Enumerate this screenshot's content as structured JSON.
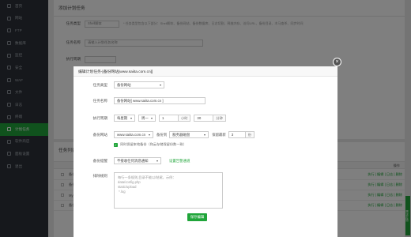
{
  "sidebar": {
    "items": [
      {
        "label": "首页"
      },
      {
        "label": "网站"
      },
      {
        "label": "FTP"
      },
      {
        "label": "数据库"
      },
      {
        "label": "监控"
      },
      {
        "label": "安全"
      },
      {
        "label": "WAF"
      },
      {
        "label": "文件"
      },
      {
        "label": "日志"
      },
      {
        "label": "终端"
      },
      {
        "label": "计划任务"
      },
      {
        "label": "软件商店"
      },
      {
        "label": "面板设置"
      },
      {
        "label": "退出"
      }
    ],
    "active_index": 10
  },
  "background": {
    "panel_title": "添加计划任务",
    "task_type_label": "任务类型",
    "task_type_value": "Shell脚本",
    "task_type_hint": "* 任务类型包含以下部分：Shell脚本、备份网站、备份数据库、日志切割、释放内存、访问URL、备份目录、木马查杀、同步时间",
    "task_name_label": "任务名称",
    "task_name_placeholder": "请输入计划任务名称",
    "exec_cycle_label": "执行周期",
    "list_title": "任务列表",
    "op_header": "操作",
    "rows": [
      {
        "name": "备份网站",
        "ops": "执行 | 编辑 | 日志 | 删除"
      },
      {
        "name": "备份数据库",
        "ops": "执行 | 编辑 | 日志 | 删除"
      },
      {
        "name": "My",
        "ops": "执行 | 编辑 | 日志 | 删除"
      },
      {
        "name": "备份",
        "ops": "执行 | 编辑 | 日志 | 删除"
      }
    ],
    "feedback": "需求反馈"
  },
  "modal": {
    "title": "编辑计划任务-[备份网站[www.saiita.com.cn]]",
    "close": "×",
    "task_type": {
      "label": "任务类型",
      "value": "备份网站"
    },
    "task_name": {
      "label": "任务名称",
      "value": "备份网站[ www.saiita.com.cn ]"
    },
    "cycle": {
      "label": "执行周期",
      "period": "每星期",
      "weekday": "周一",
      "hour": "1",
      "hour_unit": "小时",
      "minute": "30",
      "minute_unit": "分钟"
    },
    "backup": {
      "label": "备份网站",
      "site": "www.saiita.com.cn",
      "to_label": "备份到",
      "to_value": "服务器磁盘",
      "keep_label": "保留最新",
      "keep_value": "3",
      "keep_unit": "份"
    },
    "local_backup": "同时保留本地备份（和云存储保留份数一致）",
    "notify": {
      "label": "备份提醒",
      "value": "不接收任何消息通知",
      "link": "设置告警通道"
    },
    "exclude": {
      "label": "排除规则",
      "placeholder_lines": [
        "每行一条规则,目录不能以/结尾，示例：",
        "data/config.php",
        "static/upload",
        " *.log"
      ]
    },
    "save": "保存编辑"
  },
  "colors": {
    "accent": "#20a53a",
    "sidebar": "#2c3138"
  }
}
